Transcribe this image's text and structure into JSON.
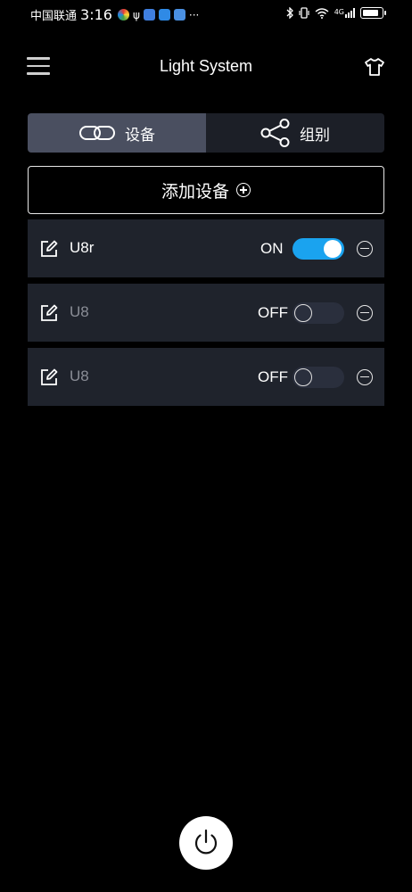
{
  "status_bar": {
    "carrier": "中国联通",
    "time": "3:16",
    "more": "···",
    "signal_label": "4G",
    "icons": [
      "color-wheel-icon",
      "usb-icon",
      "app-icon",
      "bulb-icon",
      "cloud-icon",
      "bluetooth-icon",
      "vibrate-icon",
      "wifi-icon",
      "signal-icon",
      "battery-icon"
    ]
  },
  "header": {
    "title": "Light System",
    "menu_icon": "hamburger-menu-icon",
    "right_icon": "t-shirt-icon"
  },
  "tabs": [
    {
      "label": "设备",
      "icon": "link-icon",
      "active": true
    },
    {
      "label": "组别",
      "icon": "share-icon",
      "active": false
    }
  ],
  "add_device": {
    "label": "添加设备",
    "icon": "plus-circle-icon"
  },
  "devices": [
    {
      "name": "U8r",
      "state": "ON",
      "on": true
    },
    {
      "name": "U8",
      "state": "OFF",
      "on": false
    },
    {
      "name": "U8",
      "state": "OFF",
      "on": false
    }
  ],
  "colors": {
    "background": "#000000",
    "row_background": "#1f232c",
    "active_tab": "#4a4f60",
    "toggle_on": "#1aa3ef",
    "toggle_off": "#2a2f3d"
  },
  "power_icon": "power-icon"
}
